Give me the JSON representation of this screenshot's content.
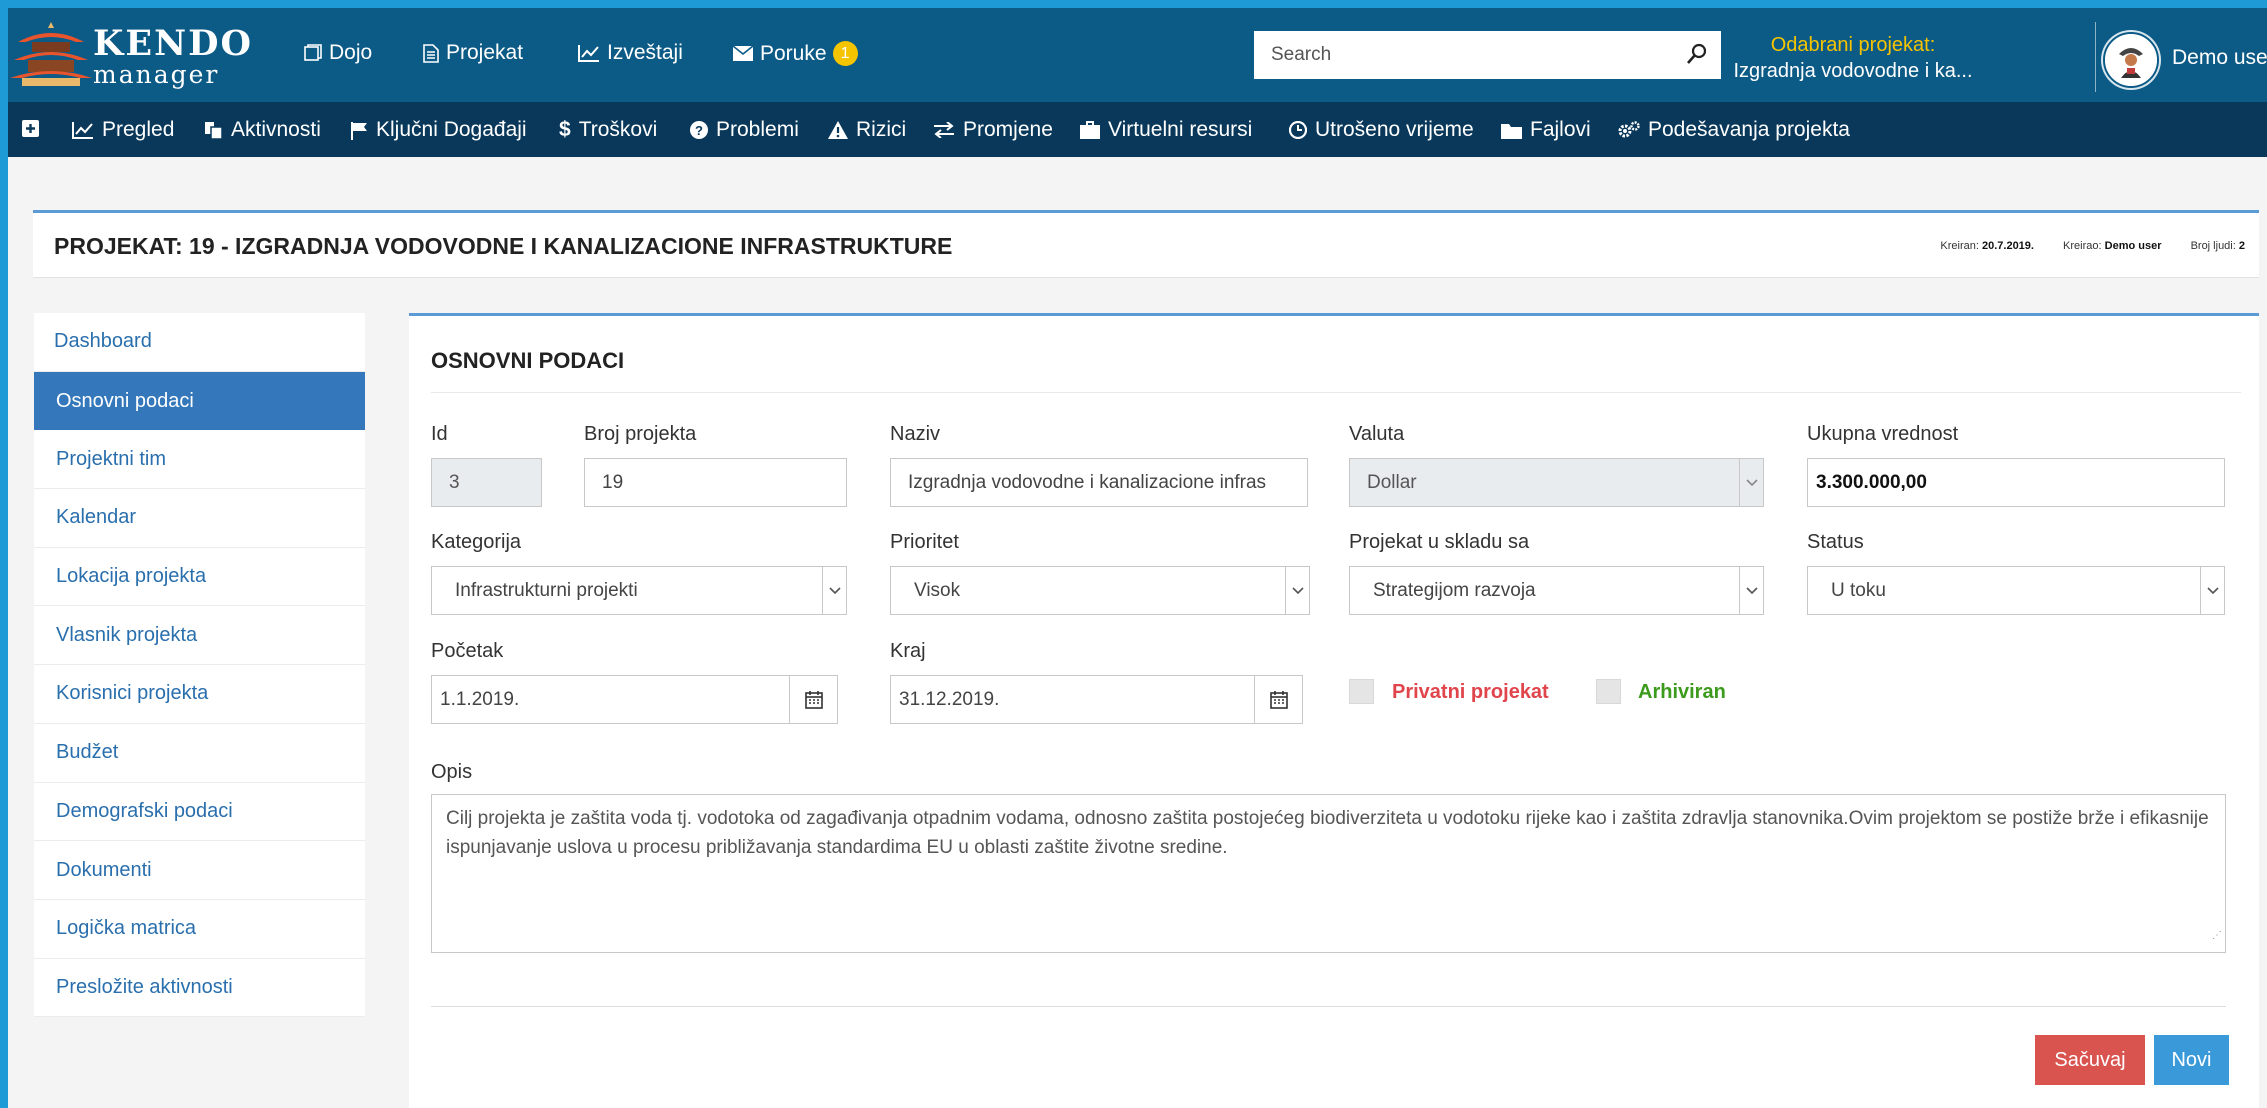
{
  "app": {
    "brand_top": "KENDO",
    "brand_bottom": "manager"
  },
  "topnav": {
    "dojo": "Dojo",
    "projekat": "Projekat",
    "izvestaji": "Izveštaji",
    "poruke": "Poruke",
    "poruke_badge": "1"
  },
  "search": {
    "placeholder": "Search"
  },
  "selected_project": {
    "label": "Odabrani projekat:",
    "value": "Izgradnja vodovodne i ka..."
  },
  "user": {
    "name": "Demo user"
  },
  "subnav": {
    "pregled": "Pregled",
    "aktivnosti": "Aktivnosti",
    "kljucni": "Ključni Događaji",
    "troskovi": "Troškovi",
    "problemi": "Problemi",
    "rizici": "Rizici",
    "promjene": "Promjene",
    "virtuelni": "Virtuelni resursi",
    "utroseno": "Utrošeno vrijeme",
    "fajlovi": "Fajlovi",
    "podesavanja": "Podešavanja projekta"
  },
  "project_header": {
    "title": "PROJEKAT: 19 - IZGRADNJA VODOVODNE I KANALIZACIONE INFRASTRUKTURE",
    "created_label": "Kreiran:",
    "created_value": "20.7.2019.",
    "created_by_label": "Kreirao:",
    "created_by_value": "Demo user",
    "people_label": "Broj ljudi:",
    "people_value": "2"
  },
  "left_menu": [
    "Dashboard",
    "Osnovni podaci",
    "Projektni tim",
    "Kalendar",
    "Lokacija projekta",
    "Vlasnik projekta",
    "Korisnici projekta",
    "Budžet",
    "Demografski podaci",
    "Dokumenti",
    "Logička matrica",
    "Presložite aktivnosti"
  ],
  "form": {
    "title": "OSNOVNI PODACI",
    "id_label": "Id",
    "id_value": "3",
    "broj_label": "Broj projekta",
    "broj_value": "19",
    "naziv_label": "Naziv",
    "naziv_value": "Izgradnja vodovodne i kanalizacione infras",
    "valuta_label": "Valuta",
    "valuta_value": "Dollar",
    "ukupna_label": "Ukupna vrednost",
    "ukupna_value": "3.300.000,00",
    "kategorija_label": "Kategorija",
    "kategorija_value": "Infrastrukturni projekti",
    "prioritet_label": "Prioritet",
    "prioritet_value": "Visok",
    "uskladu_label": "Projekat u skladu sa",
    "uskladu_value": "Strategijom razvoja",
    "status_label": "Status",
    "status_value": "U toku",
    "pocetak_label": "Početak",
    "pocetak_value": "1.1.2019.",
    "kraj_label": "Kraj",
    "kraj_value": "31.12.2019.",
    "privatni_label": "Privatni projekat",
    "arhiviran_label": "Arhiviran",
    "opis_label": "Opis",
    "opis_value": "Cilj projekta je zaštita voda tj. vodotoka od zagađivanja otpadnim vodama, odnosno zaštita postojećeg biodiverziteta u vodotoku rijeke kao i zaštita zdravlja stanovnika.Ovim projektom se postiže brže i efikasnije ispunjavanje uslova u procesu približavanja standardima EU u oblasti zaštite životne sredine.",
    "save_label": "Sačuvaj",
    "new_label": "Novi"
  },
  "colors": {
    "accent": "#3478bb",
    "topbar": "#0c5a86",
    "subnav": "#09385a",
    "save": "#d9534f",
    "new": "#3a9ad9",
    "private": "#e0454c",
    "archived": "#3c9a1c"
  }
}
